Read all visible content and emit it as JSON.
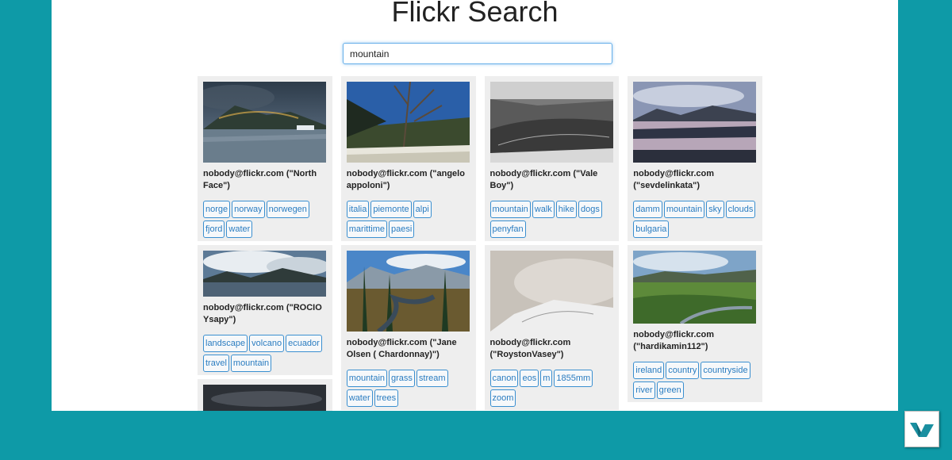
{
  "page": {
    "title": "Flickr Search"
  },
  "search": {
    "value": "mountain"
  },
  "columns": [
    [
      {
        "author": "nobody@flickr.com (\"North Face\")",
        "tags": [
          "norge",
          "norway",
          "norwegen",
          "fjord",
          "water"
        ]
      },
      {
        "author": "nobody@flickr.com (\"ROCIO Ysapy\")",
        "tags": [
          "landscape",
          "volcano",
          "ecuador",
          "travel",
          "mountain"
        ]
      },
      {
        "author": "",
        "tags": []
      }
    ],
    [
      {
        "author": "nobody@flickr.com (\"angelo appoloni\")",
        "tags": [
          "italia",
          "piemonte",
          "alpi",
          "marittime",
          "paesi"
        ]
      },
      {
        "author": "nobody@flickr.com (\"Jane Olsen ( Chardonnay)\")",
        "tags": [
          "mountain",
          "grass",
          "stream",
          "water",
          "trees"
        ]
      }
    ],
    [
      {
        "author": "nobody@flickr.com (\"Vale Boy\")",
        "tags": [
          "mountain",
          "walk",
          "hike",
          "dogs",
          "penyfan"
        ]
      },
      {
        "author": "nobody@flickr.com (\"RoystonVasey\")",
        "tags": [
          "canon",
          "eos",
          "m",
          "1855mm",
          "zoom"
        ]
      }
    ],
    [
      {
        "author": "nobody@flickr.com (\"sevdelinkata\")",
        "tags": [
          "damm",
          "mountain",
          "sky",
          "clouds",
          "bulgaria"
        ]
      },
      {
        "author": "nobody@flickr.com (\"hardikamin112\")",
        "tags": [
          "ireland",
          "country",
          "countryside",
          "river",
          "green"
        ]
      }
    ]
  ]
}
